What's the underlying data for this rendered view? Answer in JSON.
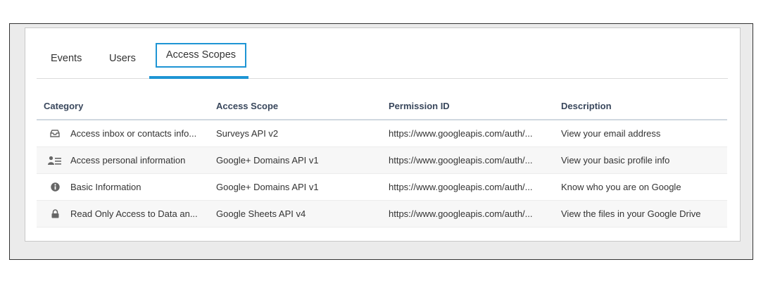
{
  "tabs": [
    {
      "label": "Events"
    },
    {
      "label": "Users"
    },
    {
      "label": "Access Scopes"
    }
  ],
  "active_tab": "Access Scopes",
  "accent_color": "#1e95d4",
  "table": {
    "headers": [
      "Category",
      "Access Scope",
      "Permission ID",
      "Description"
    ],
    "rows": [
      {
        "icon": "inbox-icon",
        "category": "Access inbox or contacts info...",
        "scope": "Surveys API v2",
        "permission": "https://www.googleapis.com/auth/...",
        "description": "View your email address"
      },
      {
        "icon": "person-list-icon",
        "category": "Access personal information",
        "scope": "Google+ Domains API v1",
        "permission": "https://www.googleapis.com/auth/...",
        "description": "View your basic profile info"
      },
      {
        "icon": "info-icon",
        "category": "Basic Information",
        "scope": "Google+ Domains API v1",
        "permission": "https://www.googleapis.com/auth/...",
        "description": "Know who you are on Google"
      },
      {
        "icon": "lock-icon",
        "category": "Read Only Access to Data an...",
        "scope": "Google Sheets API v4",
        "permission": "https://www.googleapis.com/auth/...",
        "description": "View the files in your Google Drive"
      }
    ]
  }
}
